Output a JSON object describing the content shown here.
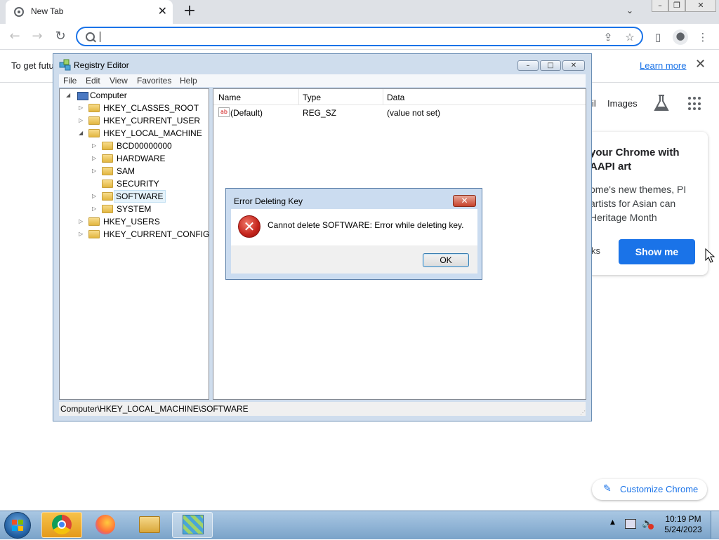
{
  "browser": {
    "tab_title": "New Tab",
    "tab_close": "✕",
    "new_tab": "+",
    "infobar_text": "To get futu",
    "learn_more": "Learn more",
    "page": {
      "gmail_partial": "il",
      "images": "Images",
      "promo_heading": "your Chrome with AAPI art",
      "promo_body": "ome's new themes, PI artists for Asian can Heritage Month",
      "promo_link_partial": "ks",
      "show_me": "Show me",
      "customize": "Customize Chrome"
    }
  },
  "regedit": {
    "title": "Registry Editor",
    "menu": [
      "File",
      "Edit",
      "View",
      "Favorites",
      "Help"
    ],
    "tree": {
      "root": "Computer",
      "hives": [
        "HKEY_CLASSES_ROOT",
        "HKEY_CURRENT_USER",
        "HKEY_LOCAL_MACHINE",
        "HKEY_USERS",
        "HKEY_CURRENT_CONFIG"
      ],
      "hklm_children": [
        "BCD00000000",
        "HARDWARE",
        "SAM",
        "SECURITY",
        "SOFTWARE",
        "SYSTEM"
      ],
      "selected": "SOFTWARE"
    },
    "columns": [
      "Name",
      "Type",
      "Data"
    ],
    "values": [
      {
        "name": "(Default)",
        "type": "REG_SZ",
        "data": "(value not set)"
      }
    ],
    "value_icon": "ab",
    "status_path": "Computer\\HKEY_LOCAL_MACHINE\\SOFTWARE"
  },
  "dialog": {
    "title": "Error Deleting Key",
    "message": "Cannot delete SOFTWARE:  Error while deleting key.",
    "ok": "OK",
    "icon": "error-icon"
  },
  "taskbar": {
    "time": "10:19 PM",
    "date": "5/24/2023"
  },
  "colors": {
    "chrome_accent": "#1a73e8",
    "window_frame": "#cfdded",
    "taskbar": "#7aa3c9",
    "error_red": "#c4231b"
  }
}
